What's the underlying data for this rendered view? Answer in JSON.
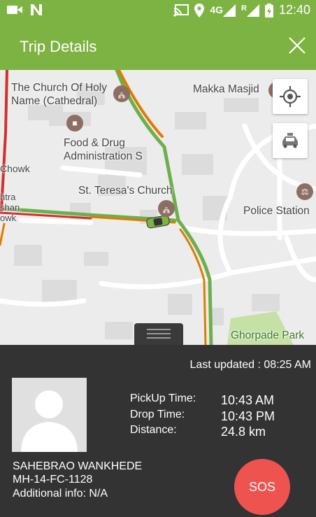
{
  "status_bar": {
    "time": "12:40",
    "network": "4G",
    "roaming": "R",
    "icons": [
      "video-camera-icon",
      "n-logo-icon",
      "cast-icon",
      "location-icon",
      "signal-icon",
      "signal-roaming-icon",
      "battery-icon"
    ]
  },
  "app_bar": {
    "title": "Trip Details",
    "close_icon": "close-icon"
  },
  "map": {
    "places": [
      {
        "name": "The Church Of Holy\nName (Cathedral)"
      },
      {
        "name": "Makka Masjid"
      },
      {
        "name": "Food & Drug\nAdministration S"
      },
      {
        "name": "St. Teresa's Church"
      },
      {
        "name": "Police Station"
      },
      {
        "name": "Ghorpade Park"
      },
      {
        "name": "Chowk"
      },
      {
        "name": "htra\nshan\nowk"
      }
    ],
    "buttons": [
      "my-location-icon",
      "taxi-icon"
    ]
  },
  "trip": {
    "last_updated_label": "Last updated : ",
    "last_updated": "08:25 AM",
    "pickup_label": "PickUp Time:",
    "pickup_time": "10:43 AM",
    "drop_label": "Drop Time:",
    "drop_time": "10:43 PM",
    "distance_label": "Distance:",
    "distance": "24.8 km"
  },
  "driver": {
    "name": "SAHEBRAO WANKHEDE",
    "vehicle": "MH-14-FC-1128",
    "additional_info": "Additional info: N/A"
  },
  "sos_label": "SOS",
  "colors": {
    "accent": "#7cb342",
    "panel": "#333333",
    "sos": "#ef5350",
    "traffic_green": "#6ab04c",
    "traffic_orange": "#e07b00",
    "traffic_red": "#d32f2f"
  }
}
